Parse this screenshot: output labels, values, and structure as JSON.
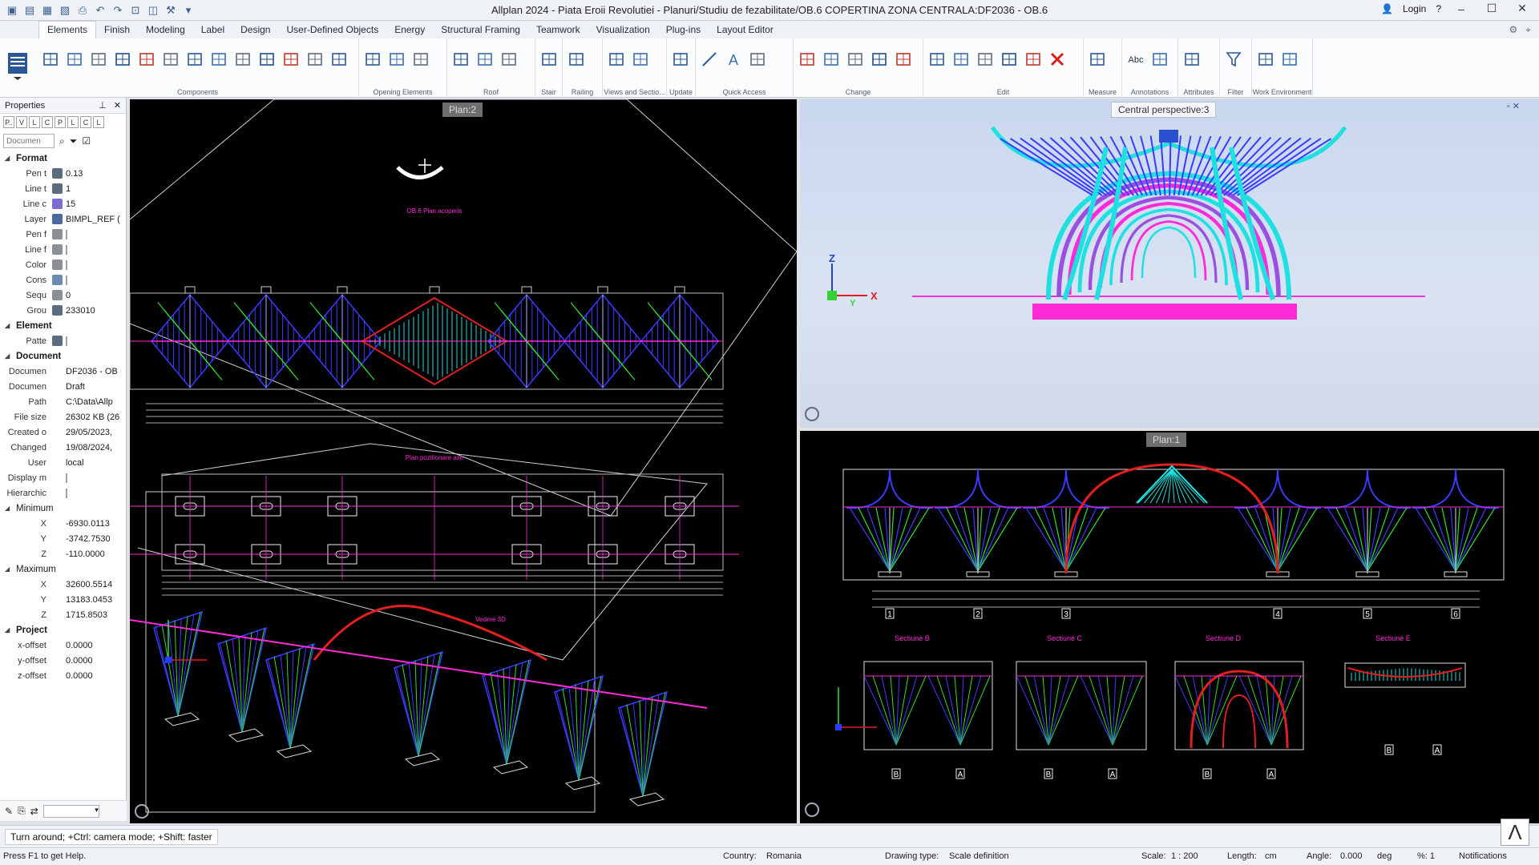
{
  "titlebar": {
    "title": "Allplan 2024 - Piata Eroii Revolutiei - Planuri/Studiu de fezabilitate/OB.6 COPERTINA ZONA CENTRALA:DF2036 - OB.6",
    "login": "Login"
  },
  "tabs": [
    "Elements",
    "Finish",
    "Modeling",
    "Label",
    "Design",
    "User-Defined Objects",
    "Energy",
    "Structural Framing",
    "Teamwork",
    "Visualization",
    "Plug-ins",
    "Layout Editor"
  ],
  "ribbon_groups": [
    "Components",
    "Opening Elements",
    "Roof",
    "Stair",
    "Railing",
    "Views and Sectio...",
    "Update",
    "Quick Access",
    "Change",
    "Edit",
    "Measure",
    "Annotations",
    "Attributes",
    "Filter",
    "Work Environment"
  ],
  "props": {
    "title": "Properties",
    "filters": [
      "P..",
      "V",
      "L",
      "C",
      "P",
      "L",
      "C",
      "L"
    ],
    "search_placeholder": "Documen",
    "sections": {
      "format": "Format",
      "element": "Element",
      "document": "Document",
      "minimum": "Minimum",
      "maximum": "Maximum",
      "project": "Project"
    },
    "format_rows": [
      {
        "label": "Pen t",
        "value": "0.13"
      },
      {
        "label": "Line t",
        "value": "1"
      },
      {
        "label": "Line c",
        "value": "15"
      },
      {
        "label": "Layer",
        "value": "BIMPL_REF ("
      },
      {
        "label": "Pen f",
        "value": ""
      },
      {
        "label": "Line f",
        "value": ""
      },
      {
        "label": "Color",
        "value": ""
      },
      {
        "label": "Cons",
        "value": ""
      },
      {
        "label": "Sequ",
        "value": "0"
      },
      {
        "label": "Grou",
        "value": "233010"
      }
    ],
    "element_rows": [
      {
        "label": "Patte",
        "value": ""
      }
    ],
    "document_rows": [
      {
        "label": "Documen",
        "value": "DF2036 - OB"
      },
      {
        "label": "Documen",
        "value": "Draft"
      },
      {
        "label": "Path",
        "value": "C:\\Data\\Allp"
      },
      {
        "label": "File size",
        "value": "26302 KB (26"
      },
      {
        "label": "Created o",
        "value": "29/05/2023,"
      },
      {
        "label": "Changed",
        "value": "19/08/2024,"
      },
      {
        "label": "User",
        "value": "local"
      },
      {
        "label": "Display m",
        "value": ""
      },
      {
        "label": "Hierarchic",
        "value": ""
      }
    ],
    "minimum_rows": [
      {
        "label": "X",
        "value": "-6930.0113"
      },
      {
        "label": "Y",
        "value": "-3742.7530"
      },
      {
        "label": "Z",
        "value": "-110.0000"
      }
    ],
    "maximum_rows": [
      {
        "label": "X",
        "value": "32600.5514"
      },
      {
        "label": "Y",
        "value": "13183.0453"
      },
      {
        "label": "Z",
        "value": "1715.8503"
      }
    ],
    "project_rows": [
      {
        "label": "x-offset",
        "value": "0.0000"
      },
      {
        "label": "y-offset",
        "value": "0.0000"
      },
      {
        "label": "z-offset",
        "value": "0.0000"
      }
    ]
  },
  "viewports": {
    "left_label": "Plan:2",
    "persp_label": "Central perspective:3",
    "br_label": "Plan:1",
    "left_titles": [
      "OB.6 Plan acoperis",
      "Plan pozitionare axe",
      "Vedere 3D"
    ],
    "br_titles": [
      "Sectiune B",
      "Sectiune C",
      "Sectiune D",
      "Sectiune E"
    ],
    "axis_numbers": [
      "1",
      "2",
      "3",
      "4",
      "5",
      "6"
    ],
    "axis_letters": [
      "B",
      "A"
    ]
  },
  "commandline": "Turn around; +Ctrl: camera mode; +Shift: faster",
  "status": {
    "help": "Press F1 to get Help.",
    "country_label": "Country:",
    "country": "Romania",
    "drawing_type_label": "Drawing type:",
    "drawing_type": "Scale definition",
    "scale_label": "Scale:",
    "scale": "1 : 200",
    "length_label": "Length:",
    "length": "cm",
    "angle_label": "Angle:",
    "angle": "0.000",
    "angle_unit": "deg",
    "percent": "%: 1",
    "notifications": "Notifications"
  },
  "colors": {
    "accent": "#2b5797",
    "blue_struct": "#3b3bff",
    "green_struct": "#2fe02f",
    "cyan_struct": "#1fe0e0",
    "magenta": "#ff2bd6",
    "red": "#e0201f"
  }
}
